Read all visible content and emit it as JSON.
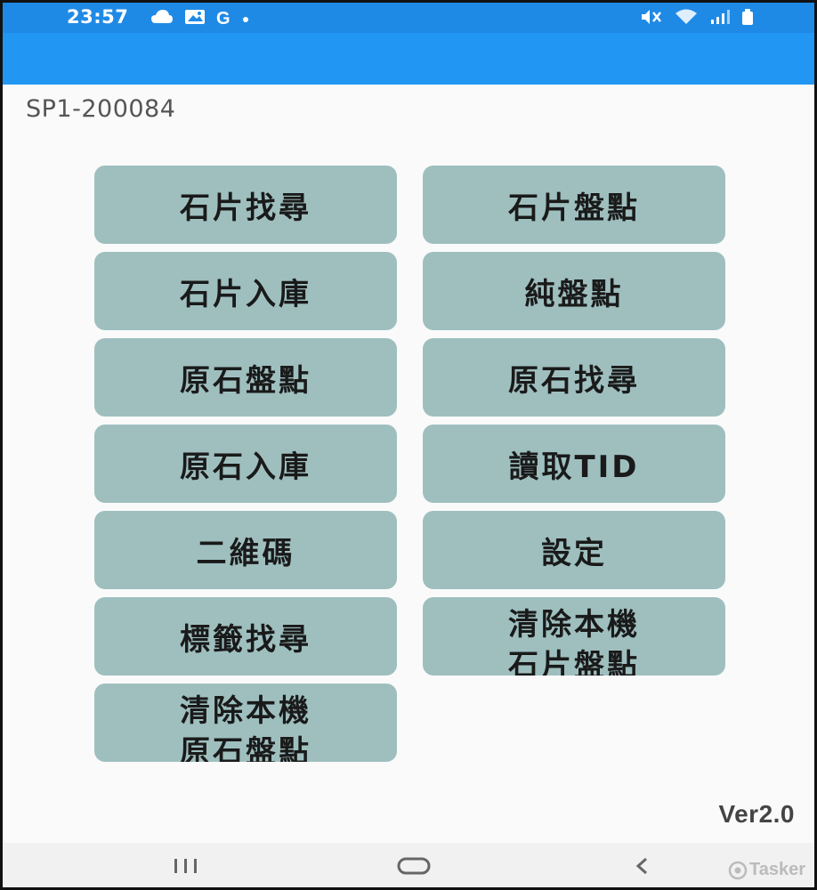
{
  "status_bar": {
    "time": "23:57",
    "notification_icons": [
      "cloud-icon",
      "gallery-icon",
      "google-icon",
      "dot-icon"
    ],
    "google_letter": "G",
    "system_icons": [
      "mute-icon",
      "wifi-icon",
      "signal-icon",
      "battery-icon"
    ]
  },
  "app_bar": {
    "color": "#2196f3"
  },
  "device_id": "SP1-200084",
  "buttons": {
    "stone_find": "石片找尋",
    "stone_inventory": "石片盤點",
    "stone_warehouse_in": "石片入庫",
    "pure_inventory": "純盤點",
    "raw_inventory": "原石盤點",
    "raw_find": "原石找尋",
    "raw_warehouse_in": "原石入庫",
    "read_tid": "讀取TID",
    "qr_code": "二維碼",
    "settings": "設定",
    "tag_find": "標籤找尋",
    "clear_stone_line1": "清除本機",
    "clear_stone_line2": "石片盤點",
    "clear_raw_line1": "清除本機",
    "clear_raw_line2": "原石盤點"
  },
  "version": "Ver2.0",
  "nav_bar": {
    "items": [
      "recent-apps-icon",
      "home-icon",
      "back-icon"
    ]
  },
  "watermark": {
    "text": "Tasker"
  },
  "colors": {
    "status_bar": "#1f8ae6",
    "button_bg": "#9fbfbf",
    "button_text": "#1a1a1a",
    "background": "#fafafa"
  }
}
